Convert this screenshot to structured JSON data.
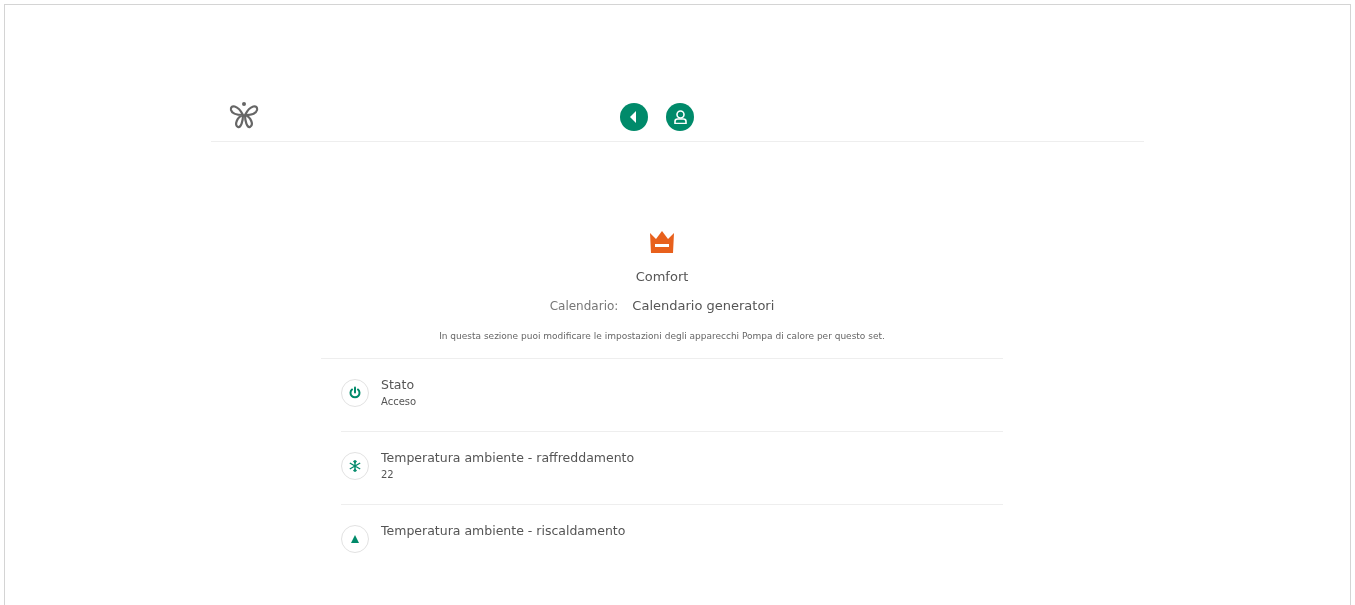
{
  "mode": {
    "name": "Comfort",
    "calendar_label": "Calendario:",
    "calendar_value": "Calendario generatori",
    "description": "In questa sezione puoi modificare le impostazioni degli apparecchi Pompa di calore per questo set."
  },
  "settings": [
    {
      "kind": "power",
      "title": "Stato",
      "value": "Acceso"
    },
    {
      "kind": "cooling",
      "title": "Temperatura ambiente - raffreddamento",
      "value": "22"
    },
    {
      "kind": "heating",
      "title": "Temperatura ambiente - riscaldamento"
    }
  ]
}
